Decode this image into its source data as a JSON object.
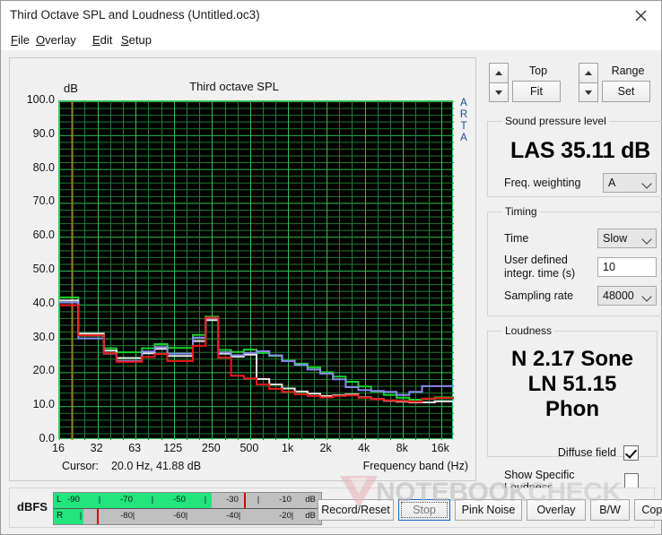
{
  "window": {
    "title": "Third Octave SPL and Loudness (Untitled.oc3)",
    "close_icon": "close-icon"
  },
  "menu": [
    {
      "label": "File",
      "mnemonic": "F",
      "rest": "ile"
    },
    {
      "label": "Overlay",
      "mnemonic": "O",
      "rest": "verlay"
    },
    {
      "label": "Edit",
      "mnemonic": "E",
      "rest": "dit"
    },
    {
      "label": "Setup",
      "mnemonic": "S",
      "rest": "etup"
    }
  ],
  "chart": {
    "title": "Third octave SPL",
    "y_axis_unit": "dB",
    "x_axis_label": "Frequency band (Hz)",
    "watermark_text": "ARTA",
    "cursor_label": "Cursor:",
    "cursor_value": "20.0 Hz, 41.88 dB"
  },
  "chart_data": {
    "type": "line",
    "title": "Third octave SPL",
    "xlabel": "Frequency band (Hz)",
    "ylabel": "dB",
    "ylim": [
      0.0,
      100.0
    ],
    "ytick_labels": [
      "100.0",
      "90.0",
      "80.0",
      "70.0",
      "60.0",
      "50.0",
      "40.0",
      "30.0",
      "20.0",
      "10.0",
      "0.0"
    ],
    "yticks": [
      100,
      90,
      80,
      70,
      60,
      50,
      40,
      30,
      20,
      10,
      0
    ],
    "grid": true,
    "grid_color": "#1f7a33",
    "grid_major_color": "#2fbf4f",
    "plot_background": "#000000",
    "legend": "none",
    "style": "step",
    "xtick_labels": [
      "16",
      "32",
      "63",
      "125",
      "250",
      "500",
      "1k",
      "2k",
      "4k",
      "8k",
      "16k"
    ],
    "x_bands": [
      16,
      20,
      25,
      31.5,
      40,
      50,
      63,
      80,
      100,
      125,
      160,
      200,
      250,
      315,
      400,
      500,
      630,
      800,
      1000,
      1250,
      1600,
      2000,
      2500,
      3150,
      4000,
      5000,
      6300,
      8000,
      10000,
      12500,
      16000,
      20000
    ],
    "cursor": {
      "frequency_hz": 20.0,
      "level_db": 41.88,
      "color": "#9a8324"
    },
    "series": [
      {
        "name": "green",
        "color": "#17d22a",
        "values": [
          42.1,
          42.1,
          30.8,
          30.8,
          27.1,
          25.9,
          25.9,
          27.1,
          28.3,
          27.2,
          27.2,
          31.0,
          36.4,
          26.6,
          26.0,
          26.7,
          25.7,
          24.8,
          23.4,
          22.5,
          21.4,
          20.0,
          18.7,
          17.2,
          15.8,
          14.3,
          13.3,
          12.5,
          11.9,
          12.2,
          12.6,
          12.6
        ]
      },
      {
        "name": "white",
        "color": "#e8e8e8",
        "values": [
          41.2,
          41.2,
          31.4,
          31.4,
          26.4,
          24.2,
          24.2,
          25.6,
          26.9,
          24.8,
          24.8,
          29.2,
          35.4,
          25.5,
          24.6,
          25.2,
          18.0,
          16.4,
          15.2,
          14.3,
          13.7,
          13.0,
          13.2,
          13.4,
          12.6,
          12.1,
          11.6,
          11.3,
          11.1,
          11.1,
          11.4,
          11.4
        ]
      },
      {
        "name": "blue",
        "color": "#8b8bf0",
        "values": [
          40.6,
          40.6,
          30.0,
          30.0,
          25.5,
          23.3,
          23.3,
          26.1,
          27.4,
          25.5,
          25.5,
          30.2,
          35.9,
          25.9,
          25.0,
          25.7,
          26.2,
          25.0,
          23.3,
          22.2,
          20.8,
          19.6,
          17.9,
          15.6,
          14.7,
          14.5,
          14.2,
          13.3,
          14.2,
          15.9,
          15.9,
          15.9
        ]
      },
      {
        "name": "red",
        "color": "#f01818",
        "values": [
          39.8,
          39.8,
          30.9,
          30.9,
          25.6,
          23.1,
          23.1,
          24.5,
          25.4,
          23.3,
          23.3,
          27.8,
          36.1,
          24.3,
          19.0,
          18.2,
          16.4,
          15.1,
          14.2,
          13.5,
          13.0,
          12.6,
          13.0,
          13.2,
          12.5,
          12.1,
          11.7,
          11.5,
          11.3,
          12.2,
          12.4,
          12.4
        ]
      }
    ]
  },
  "top_control": {
    "label": "Top",
    "button": "Fit",
    "up_icon": "caret-up-icon",
    "down_icon": "caret-down-icon"
  },
  "range_control": {
    "label": "Range",
    "button": "Set",
    "up_icon": "caret-up-icon",
    "down_icon": "caret-down-icon"
  },
  "spl": {
    "group_label": "Sound pressure level",
    "value": "LAS 35.11 dB",
    "weighting_label": "Freq. weighting",
    "weighting_value": "A"
  },
  "timing": {
    "group_label": "Timing",
    "time_label": "Time",
    "time_value": "Slow",
    "integration_label_1": "User defined",
    "integration_label_2": "integr. time (s)",
    "integration_value": "10",
    "sampling_label": "Sampling rate",
    "sampling_value": "48000"
  },
  "loudness": {
    "group_label": "Loudness",
    "value_line_1": "N 2.17 Sone",
    "value_line_2": "LN 51.15 Phon",
    "diffuse_field_label": "Diffuse field",
    "diffuse_field_checked": true,
    "specific_loudness_label": "Show Specific Loudness",
    "specific_loudness_checked": false
  },
  "meter": {
    "unit_label": "dBFS",
    "left_channel": "L",
    "right_channel": "R",
    "unit_right": "dB",
    "top_ticks": [
      "-90",
      "-70",
      "-50",
      "-30",
      "-10"
    ],
    "bottom_ticks": [
      "-80",
      "-60",
      "-40",
      "-20"
    ],
    "left_fill_percent": 59,
    "left_peak_percent": 71,
    "right_fill_percent": 11,
    "right_peak_percent": 16,
    "fill_color": "#22e57e",
    "peak_color": "#e30000"
  },
  "buttons": [
    {
      "label": "Record/Reset",
      "state": "normal"
    },
    {
      "label": "Stop",
      "state": "focused"
    },
    {
      "label": "Pink Noise",
      "state": "normal"
    },
    {
      "label": "Overlay",
      "state": "normal"
    },
    {
      "label": "B/W",
      "state": "normal"
    },
    {
      "label": "Copy",
      "state": "normal"
    }
  ],
  "watermark": {
    "text_bold": "NOTEBOOK",
    "text_light": "CHECK"
  }
}
